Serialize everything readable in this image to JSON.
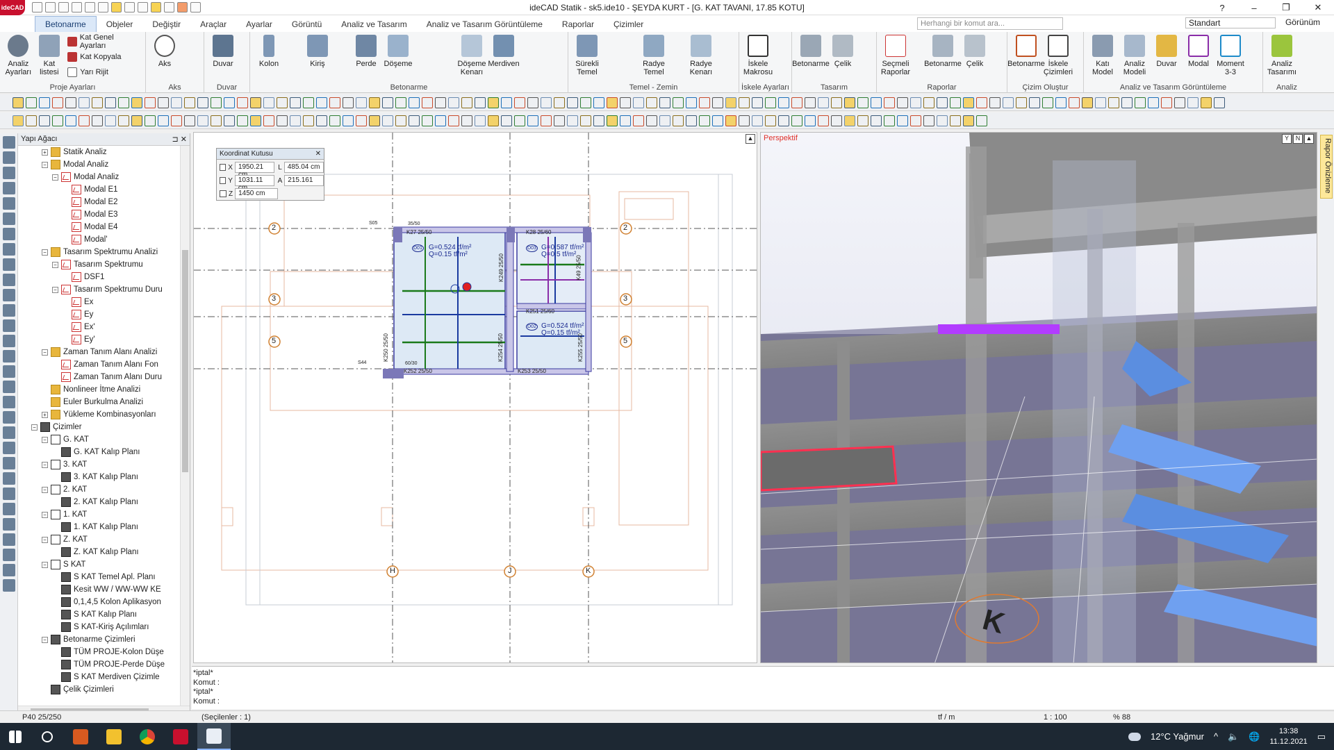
{
  "app": {
    "logo": "ideCAD",
    "title": "ideCAD Statik - sk5.ide10 - ŞEYDA KURT - [G. KAT TAVANI, 17.85 KOTU]"
  },
  "tabs": [
    "Betonarme",
    "Objeler",
    "Değiştir",
    "Araçlar",
    "Ayarlar",
    "Görüntü",
    "Analiz ve Tasarım",
    "Analiz ve Tasarım Görüntüleme",
    "Raporlar",
    "Çizimler"
  ],
  "search": {
    "placeholder": "Herhangi bir komut ara..."
  },
  "style_select": "Standart",
  "view_menu": "Görünüm",
  "ribbon": {
    "proje": {
      "label": "Proje Ayarları",
      "btn1": "Analiz Ayarları",
      "btn2": "Kat listesi",
      "s1": "Kat Genel Ayarları",
      "s2": "Kat Kopyala",
      "s3": "Yarı Rijit"
    },
    "aks": {
      "label": "Aks",
      "btn": "Aks"
    },
    "duvar": {
      "label": "Duvar",
      "btn": "Duvar"
    },
    "betonarme": {
      "label": "Betonarme",
      "b1": "Kolon",
      "b2": "Kiriş",
      "b3": "Perde",
      "b4": "Döşeme",
      "b5": "Döşeme Kenarı",
      "b6": "Merdiven"
    },
    "temel": {
      "label": "Temel - Zemin",
      "b1": "Sürekli Temel",
      "b2": "Radye Temel",
      "b3": "Radye Kenarı"
    },
    "iskele": {
      "label": "İskele Ayarları",
      "b1": "İskele Makrosu"
    },
    "tasarim": {
      "label": "Tasarım",
      "b1": "Betonarme",
      "b2": "Çelik"
    },
    "raporlar": {
      "label": "Raporlar",
      "b1": "Seçmeli Raporlar",
      "b2": "Betonarme",
      "b3": "Çelik"
    },
    "cizim": {
      "label": "Çizim Oluştur",
      "b1": "Betonarme",
      "b2": "İskele Çizimleri"
    },
    "gorunt": {
      "label": "Analiz ve Tasarım Görüntüleme",
      "b1": "Katı Model",
      "b2": "Analiz Modeli",
      "b3": "Duvar",
      "b4": "Modal",
      "b5": "Moment 3-3"
    },
    "analiz": {
      "label": "Analiz",
      "b1": "Analiz Tasarımı"
    }
  },
  "tree": {
    "title": "Yapı Ağacı",
    "nodes": [
      {
        "t": "Statik Analiz",
        "d": 2,
        "e": "+",
        "i": "folder"
      },
      {
        "t": "Modal Analiz",
        "d": 2,
        "e": "−",
        "i": "folder"
      },
      {
        "t": "Modal Analiz",
        "d": 3,
        "e": "−",
        "i": "graph"
      },
      {
        "t": "Modal E1",
        "d": 4,
        "e": "",
        "i": "graph"
      },
      {
        "t": "Modal E2",
        "d": 4,
        "e": "",
        "i": "graph"
      },
      {
        "t": "Modal E3",
        "d": 4,
        "e": "",
        "i": "graph"
      },
      {
        "t": "Modal E4",
        "d": 4,
        "e": "",
        "i": "graph"
      },
      {
        "t": "Modal'",
        "d": 4,
        "e": "",
        "i": "graph"
      },
      {
        "t": "Tasarım Spektrumu Analizi",
        "d": 2,
        "e": "−",
        "i": "folder"
      },
      {
        "t": "Tasarım Spektrumu",
        "d": 3,
        "e": "−",
        "i": "graph"
      },
      {
        "t": "DSF1",
        "d": 4,
        "e": "",
        "i": "graph"
      },
      {
        "t": "Tasarım Spektrumu Duru",
        "d": 3,
        "e": "−",
        "i": "graph"
      },
      {
        "t": "Ex",
        "d": 4,
        "e": "",
        "i": "graph"
      },
      {
        "t": "Ey",
        "d": 4,
        "e": "",
        "i": "graph"
      },
      {
        "t": "Ex'",
        "d": 4,
        "e": "",
        "i": "graph"
      },
      {
        "t": "Ey'",
        "d": 4,
        "e": "",
        "i": "graph"
      },
      {
        "t": "Zaman Tanım Alanı Analizi",
        "d": 2,
        "e": "−",
        "i": "folder"
      },
      {
        "t": "Zaman Tanım Alanı Fon",
        "d": 3,
        "e": "",
        "i": "graph"
      },
      {
        "t": "Zaman Tanım Alanı Duru",
        "d": 3,
        "e": "",
        "i": "graph"
      },
      {
        "t": "Nonlineer İtme Analizi",
        "d": 2,
        "e": "",
        "i": "folder"
      },
      {
        "t": "Euler Burkulma Analizi",
        "d": 2,
        "e": "",
        "i": "folder"
      },
      {
        "t": "Yükleme Kombinasyonları",
        "d": 2,
        "e": "+",
        "i": "folder"
      },
      {
        "t": "Çizimler",
        "d": 1,
        "e": "−",
        "i": "sheet"
      },
      {
        "t": "G. KAT",
        "d": 2,
        "e": "−",
        "i": "page"
      },
      {
        "t": "G. KAT Kalıp Planı",
        "d": 3,
        "e": "",
        "i": "sheet"
      },
      {
        "t": "3. KAT",
        "d": 2,
        "e": "−",
        "i": "page"
      },
      {
        "t": "3. KAT Kalıp Planı",
        "d": 3,
        "e": "",
        "i": "sheet"
      },
      {
        "t": "2. KAT",
        "d": 2,
        "e": "−",
        "i": "page"
      },
      {
        "t": "2. KAT Kalıp Planı",
        "d": 3,
        "e": "",
        "i": "sheet"
      },
      {
        "t": "1. KAT",
        "d": 2,
        "e": "−",
        "i": "page"
      },
      {
        "t": "1. KAT Kalıp Planı",
        "d": 3,
        "e": "",
        "i": "sheet"
      },
      {
        "t": "Z. KAT",
        "d": 2,
        "e": "−",
        "i": "page"
      },
      {
        "t": "Z. KAT Kalıp Planı",
        "d": 3,
        "e": "",
        "i": "sheet"
      },
      {
        "t": "S KAT",
        "d": 2,
        "e": "−",
        "i": "page"
      },
      {
        "t": "S KAT Temel Apl. Planı",
        "d": 3,
        "e": "",
        "i": "sheet"
      },
      {
        "t": "Kesit WW / WW-WW KE",
        "d": 3,
        "e": "",
        "i": "sheet"
      },
      {
        "t": "0,1,4,5 Kolon Aplikasyon",
        "d": 3,
        "e": "",
        "i": "sheet"
      },
      {
        "t": "S KAT Kalıp Planı",
        "d": 3,
        "e": "",
        "i": "sheet"
      },
      {
        "t": "S KAT-Kiriş Açılımları",
        "d": 3,
        "e": "",
        "i": "sheet"
      },
      {
        "t": "Betonarme Çizimleri",
        "d": 2,
        "e": "−",
        "i": "sheet"
      },
      {
        "t": "TÜM PROJE-Kolon Düşe",
        "d": 3,
        "e": "",
        "i": "sheet"
      },
      {
        "t": "TÜM PROJE-Perde Düşe",
        "d": 3,
        "e": "",
        "i": "sheet"
      },
      {
        "t": "S KAT Merdiven Çizimle",
        "d": 3,
        "e": "",
        "i": "sheet"
      },
      {
        "t": "Çelik Çizimleri",
        "d": 2,
        "e": "",
        "i": "sheet"
      }
    ]
  },
  "coord": {
    "title": "Koordinat Kutusu",
    "x_lbl": "X",
    "y_lbl": "Y",
    "z_lbl": "Z",
    "l_lbl": "L",
    "a_lbl": "A",
    "x": "1950.21 cm",
    "y": "1031.11 cm",
    "z": "1450 cm",
    "l": "485.04 cm",
    "a": "215.161"
  },
  "plan": {
    "axes_row": [
      "2",
      "3",
      "5"
    ],
    "axes_col": [
      "H",
      "J",
      "K"
    ],
    "beams": [
      "K27 25/50",
      "K28 25/60",
      "K251 25/60",
      "K252 25/50",
      "K253 25/50",
      "K250 25/50",
      "K254 25/50",
      "K255 25/50",
      "K249 25/50",
      "K49 25/50"
    ],
    "labels": [
      "S05",
      "35/50",
      "S44",
      "60/30"
    ],
    "slabs": [
      {
        "id": "D01",
        "g": "G=0.524 tf/m²",
        "q": "Q=0.15 tf/m²"
      },
      {
        "id": "D03",
        "g": "G=0.587 tf/m²",
        "q": "Q=0.5 tf/m²"
      },
      {
        "id": "D02",
        "g": "G=0.524 tf/m²",
        "q": "Q=0.15 tf/m²"
      }
    ]
  },
  "view3d": {
    "label": "Perspektif",
    "k_mark": "K"
  },
  "side_tab": "Rapor Önizleme",
  "command": {
    "lines": [
      "*iptal*",
      "Komut :",
      "*iptal*",
      "Komut :"
    ]
  },
  "status": {
    "left": "P40 25/250",
    "sel": "(Seçilenler : 1)",
    "unit": "tf / m",
    "scale": "1 : 100",
    "zoom": "% 88"
  },
  "taskbar": {
    "weather": "12°C  Yağmur",
    "time": "13:38",
    "date": "11.12.2021"
  },
  "colors": {
    "accent": "#1a5fb4",
    "brand": "#c8102e",
    "purple": "#b23cff",
    "beam_outline": "#3a3aa0"
  }
}
